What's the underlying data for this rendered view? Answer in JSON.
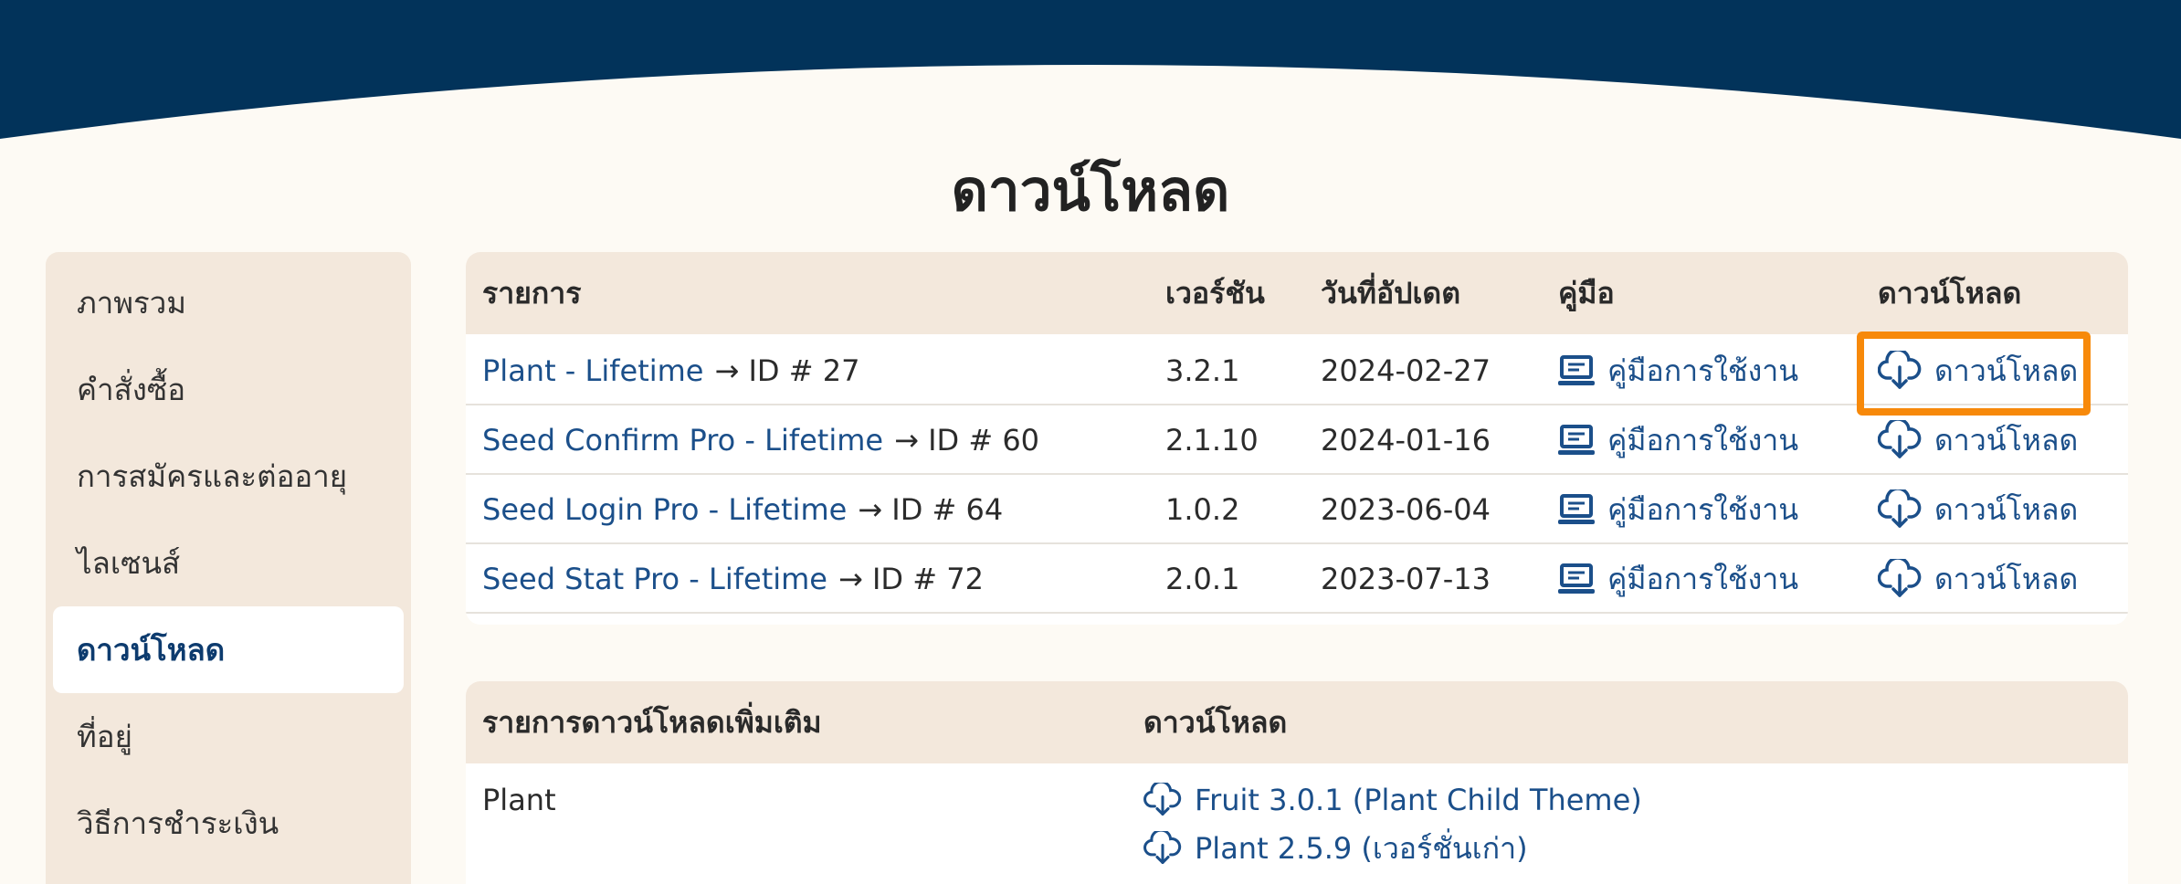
{
  "page": {
    "title": "ดาวน์โหลด"
  },
  "colors": {
    "header": "#02335a",
    "accent": "#1b4f8a",
    "highlight": "#f7890a",
    "sidebar_bg": "#f3e8dc"
  },
  "sidebar": {
    "items": [
      {
        "label": "ภาพรวม"
      },
      {
        "label": "คำสั่งซื้อ"
      },
      {
        "label": "การสมัครและต่ออายุ"
      },
      {
        "label": "ไลเซนส์"
      },
      {
        "label": "ดาวน์โหลด",
        "active": true
      },
      {
        "label": "ที่อยู่"
      },
      {
        "label": "วิธีการชำระเงิน"
      }
    ]
  },
  "downloads_table": {
    "headers": {
      "item": "รายการ",
      "version": "เวอร์ชัน",
      "updated": "วันที่อัปเดต",
      "manual": "คู่มือ",
      "download": "ดาวน์โหลด"
    },
    "rows": [
      {
        "product": "Plant - Lifetime",
        "id": "→ ID # 27",
        "version": "3.2.1",
        "date": "2024-02-27",
        "manual": "คู่มือการใช้งาน",
        "download": "ดาวน์โหลด"
      },
      {
        "product": "Seed Confirm Pro - Lifetime",
        "id": "→ ID # 60",
        "version": "2.1.10",
        "date": "2024-01-16",
        "manual": "คู่มือการใช้งาน",
        "download": "ดาวน์โหลด"
      },
      {
        "product": "Seed Login Pro - Lifetime",
        "id": "→ ID # 64",
        "version": "1.0.2",
        "date": "2023-06-04",
        "manual": "คู่มือการใช้งาน",
        "download": "ดาวน์โหลด"
      },
      {
        "product": "Seed Stat Pro - Lifetime",
        "id": "→ ID # 72",
        "version": "2.0.1",
        "date": "2023-07-13",
        "manual": "คู่มือการใช้งาน",
        "download": "ดาวน์โหลด"
      }
    ]
  },
  "extra_table": {
    "headers": {
      "item": "รายการดาวน์โหลดเพิ่มเติม",
      "download": "ดาวน์โหลด"
    },
    "rows": [
      {
        "item": "Plant",
        "links": [
          "Fruit 3.0.1 (Plant Child Theme)",
          "Plant 2.5.9 (เวอร์ชั่นเก่า)"
        ]
      }
    ]
  },
  "icons": {
    "manual": "laptop-icon",
    "download": "cloud-download-icon"
  }
}
